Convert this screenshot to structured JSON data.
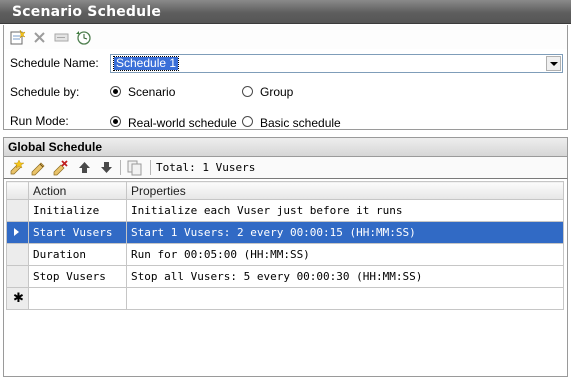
{
  "window": {
    "title": "Scenario Schedule"
  },
  "toolbar": {
    "icons": [
      "new-schedule-icon",
      "delete-icon",
      "rename-icon",
      "schedule-clock-icon"
    ]
  },
  "settings": {
    "schedule_name_label": "Schedule Name:",
    "schedule_name_value": "Schedule 1",
    "schedule_by_label": "Schedule by:",
    "schedule_by_options": [
      "Scenario",
      "Group"
    ],
    "schedule_by_selected": "Scenario",
    "run_mode_label": "Run Mode:",
    "run_mode_options": [
      "Real-world schedule",
      "Basic schedule"
    ],
    "run_mode_selected": "Real-world schedule"
  },
  "global_schedule": {
    "title": "Global Schedule",
    "toolbar_icons": [
      "add-action-icon",
      "edit-action-icon",
      "delete-action-icon",
      "move-up-icon",
      "move-down-icon",
      "copy-icon"
    ],
    "total": "Total: 1 Vusers",
    "columns": [
      "Action",
      "Properties"
    ],
    "rows": [
      {
        "action": "Initialize",
        "properties": "Initialize each Vuser just before it runs"
      },
      {
        "action": "Start  Vusers",
        "properties": "Start 1 Vusers: 2 every 00:00:15 (HH:MM:SS)"
      },
      {
        "action": "Duration",
        "properties": "Run for 00:05:00 (HH:MM:SS)"
      },
      {
        "action": "Stop Vusers",
        "properties": "Stop all Vusers: 5 every 00:00:30 (HH:MM:SS)"
      }
    ],
    "selected_row_index": 1,
    "new_row_marker": "✱"
  },
  "colors": {
    "selection": "#316ac5",
    "title_bar": "#5e5e5e"
  }
}
